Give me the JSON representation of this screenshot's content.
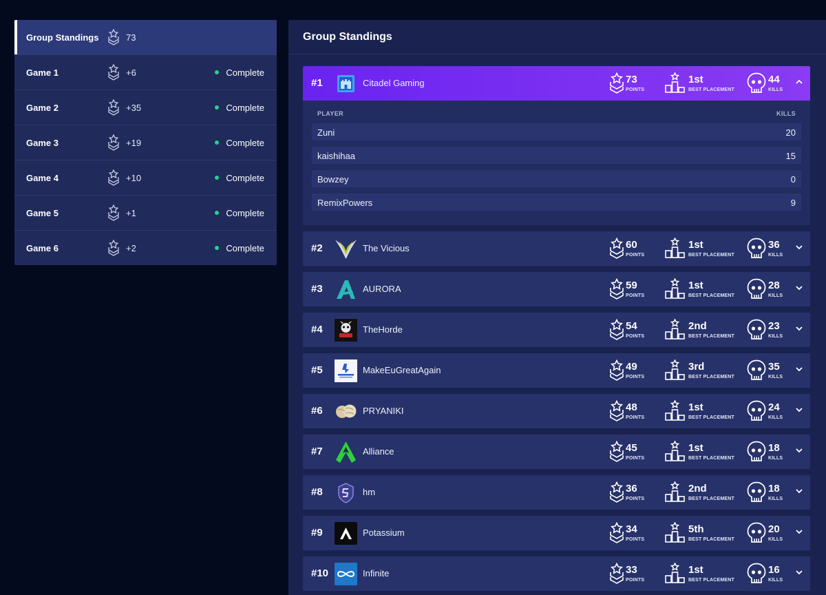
{
  "sidebar": {
    "items": [
      {
        "label": "Group Standings",
        "points": "73",
        "status": ""
      },
      {
        "label": "Game 1",
        "points": "+6",
        "status": "Complete"
      },
      {
        "label": "Game 2",
        "points": "+35",
        "status": "Complete"
      },
      {
        "label": "Game 3",
        "points": "+19",
        "status": "Complete"
      },
      {
        "label": "Game 4",
        "points": "+10",
        "status": "Complete"
      },
      {
        "label": "Game 5",
        "points": "+1",
        "status": "Complete"
      },
      {
        "label": "Game 6",
        "points": "+2",
        "status": "Complete"
      }
    ]
  },
  "main": {
    "title": "Group Standings",
    "stat_labels": {
      "points": "POINTS",
      "placement": "BEST PLACEMENT",
      "kills": "KILLS"
    },
    "player_header": "PLAYER",
    "kills_header": "KILLS",
    "teams": [
      {
        "rank": "#1",
        "name": "Citadel Gaming",
        "points": "73",
        "placement": "1st",
        "kills": "44",
        "logo": "citadel-logo",
        "players": [
          {
            "name": "Zuni",
            "kills": "20"
          },
          {
            "name": "kaishihaa",
            "kills": "15"
          },
          {
            "name": "Bowzey",
            "kills": "0"
          },
          {
            "name": "RemixPowers",
            "kills": "9"
          }
        ]
      },
      {
        "rank": "#2",
        "name": "The Vicious",
        "points": "60",
        "placement": "1st",
        "kills": "36",
        "logo": "vicious-logo"
      },
      {
        "rank": "#3",
        "name": "AURORA",
        "points": "59",
        "placement": "1st",
        "kills": "28",
        "logo": "aurora-logo"
      },
      {
        "rank": "#4",
        "name": "TheHorde",
        "points": "54",
        "placement": "2nd",
        "kills": "23",
        "logo": "horde-logo"
      },
      {
        "rank": "#5",
        "name": "MakeEuGreatAgain",
        "points": "49",
        "placement": "3rd",
        "kills": "35",
        "logo": "makeeu-logo"
      },
      {
        "rank": "#6",
        "name": "PRYANIKI",
        "points": "48",
        "placement": "1st",
        "kills": "24",
        "logo": "pryaniki-logo"
      },
      {
        "rank": "#7",
        "name": "Alliance",
        "points": "45",
        "placement": "1st",
        "kills": "18",
        "logo": "alliance-logo"
      },
      {
        "rank": "#8",
        "name": "hm",
        "points": "36",
        "placement": "2nd",
        "kills": "18",
        "logo": "hm-logo"
      },
      {
        "rank": "#9",
        "name": "Potassium",
        "points": "34",
        "placement": "5th",
        "kills": "20",
        "logo": "potassium-logo"
      },
      {
        "rank": "#10",
        "name": "Infinite",
        "points": "33",
        "placement": "1st",
        "kills": "16",
        "logo": "infinite-logo"
      }
    ]
  },
  "colors": {
    "background": "#030a1e",
    "panel": "#1a2350",
    "row": "#27326a",
    "highlight_start": "#6a23f0",
    "highlight_end": "#8a3bf3",
    "status_complete": "#22d38a"
  }
}
